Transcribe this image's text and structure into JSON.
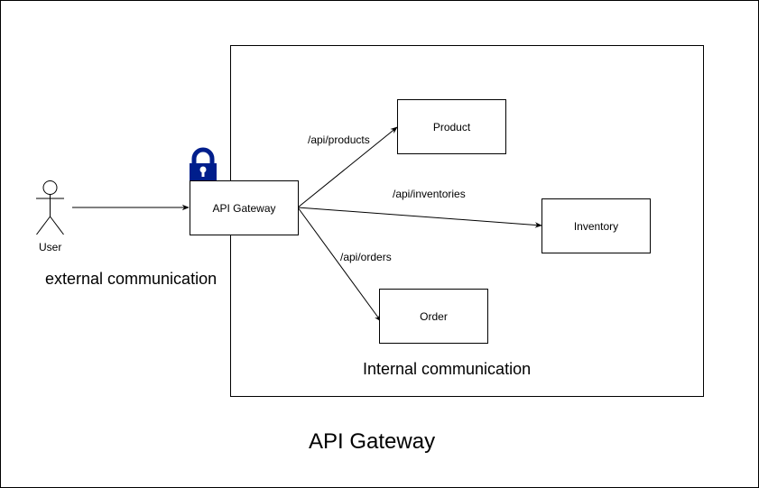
{
  "diagram": {
    "title": "API Gateway",
    "external_label": "external communication",
    "internal_label": "Internal communication",
    "actor": {
      "label": "User",
      "icon": "person-icon"
    },
    "lock": {
      "icon": "lock-icon",
      "color": "#001e8c"
    },
    "nodes": {
      "gateway": "API Gateway",
      "product": "Product",
      "inventory": "Inventory",
      "order": "Order"
    },
    "routes": {
      "products": "/api/products",
      "inventories": "/api/inventories",
      "orders": "/api/orders"
    }
  }
}
